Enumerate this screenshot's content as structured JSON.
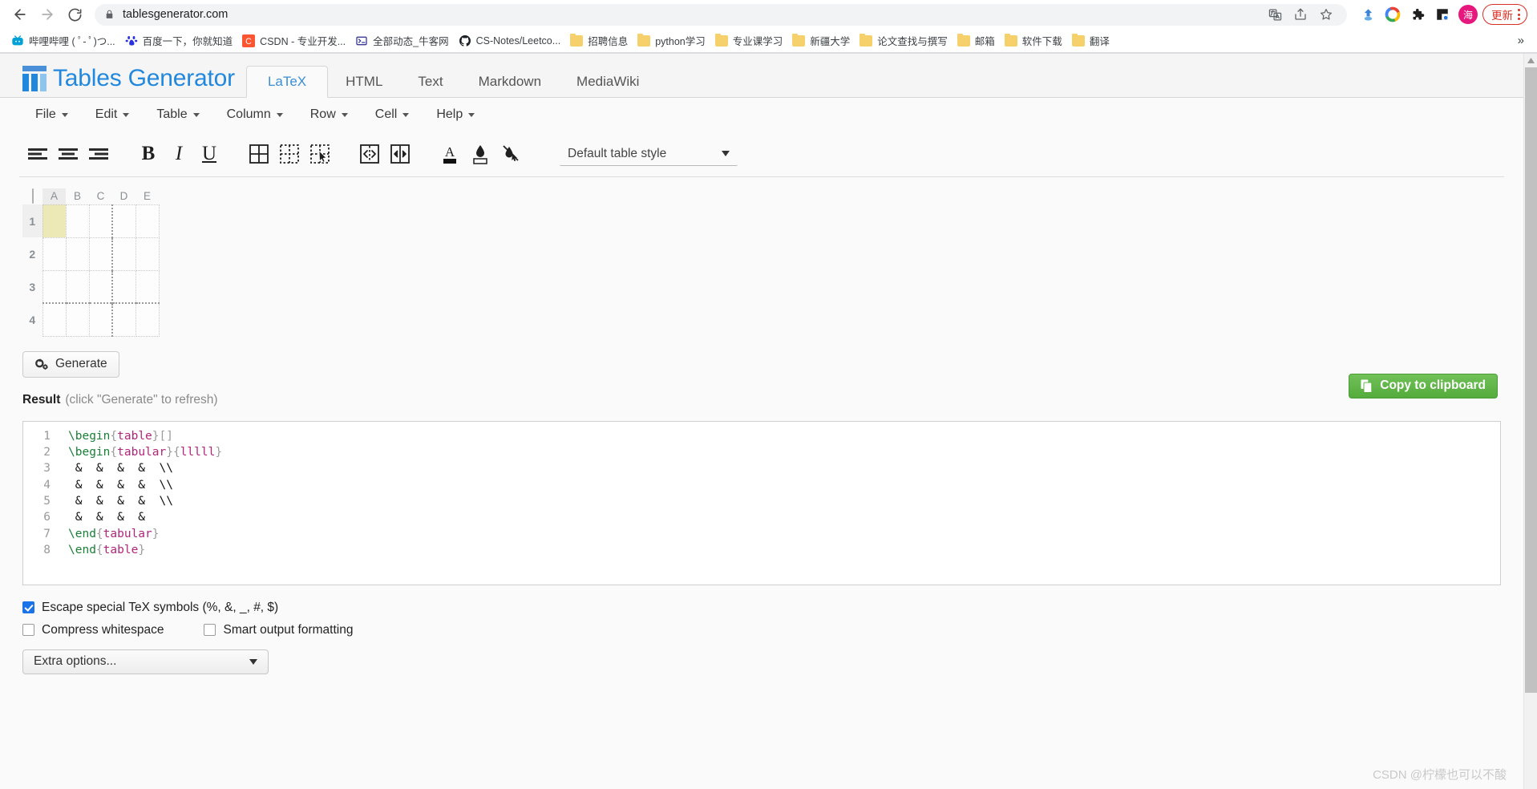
{
  "browser": {
    "back_icon": "back-arrow-icon",
    "forward_icon": "forward-arrow-icon",
    "reload_icon": "reload-icon",
    "lock_icon": "lock-icon",
    "url": "tablesgenerator.com",
    "omnibox_actions": [
      "translate-icon",
      "share-icon",
      "bookmark-star-icon"
    ],
    "extensions": [
      "blue-arrow-extension-icon",
      "google-colors-extension-icon",
      "puzzle-extensions-icon",
      "window-extension-icon"
    ],
    "profile_initial": "海",
    "update_label": "更新",
    "overflow_label": "»"
  },
  "bookmarks": [
    {
      "label": "哔哩哔哩 ( ﾟ- ﾟ)つ...",
      "icon": "bilibili-favicon"
    },
    {
      "label": "百度一下，你就知道",
      "icon": "baidu-favicon"
    },
    {
      "label": "CSDN - 专业开发...",
      "icon": "csdn-favicon"
    },
    {
      "label": "全部动态_牛客网",
      "icon": "nowcoder-favicon"
    },
    {
      "label": "CS-Notes/Leetco...",
      "icon": "github-favicon"
    },
    {
      "label": "招聘信息",
      "icon": "folder-icon"
    },
    {
      "label": "python学习",
      "icon": "folder-icon"
    },
    {
      "label": "专业课学习",
      "icon": "folder-icon"
    },
    {
      "label": "新疆大学",
      "icon": "folder-icon"
    },
    {
      "label": "论文查找与撰写",
      "icon": "folder-icon"
    },
    {
      "label": "邮箱",
      "icon": "folder-icon"
    },
    {
      "label": "软件下载",
      "icon": "folder-icon"
    },
    {
      "label": "翻译",
      "icon": "folder-icon"
    }
  ],
  "app": {
    "brand": "Tables Generator",
    "brand_color": "#2288dd",
    "format_tabs": [
      {
        "label": "LaTeX",
        "active": true
      },
      {
        "label": "HTML",
        "active": false
      },
      {
        "label": "Text",
        "active": false
      },
      {
        "label": "Markdown",
        "active": false
      },
      {
        "label": "MediaWiki",
        "active": false
      }
    ],
    "menu_items": [
      "File",
      "Edit",
      "Table",
      "Column",
      "Row",
      "Cell",
      "Help"
    ],
    "toolbar_icons": [
      "align-left-icon",
      "align-center-icon",
      "align-right-icon",
      "bold-icon",
      "italic-icon",
      "underline-icon",
      "borders-all-icon",
      "borders-none-icon",
      "borders-select-icon",
      "merge-cells-icon",
      "split-cells-icon",
      "text-color-icon",
      "fill-color-icon",
      "clear-formatting-icon"
    ],
    "table_style": {
      "selected": "Default table style",
      "caret": "chevron-down-icon"
    }
  },
  "grid": {
    "columns": [
      "A",
      "B",
      "C",
      "D",
      "E"
    ],
    "rows": [
      "1",
      "2",
      "3",
      "4"
    ],
    "selected_cell": "A1",
    "selected_fill": "#ece9b6",
    "heavy_column_left_border": "D",
    "heavy_row_top_border": "4"
  },
  "actions": {
    "generate_label": "Generate",
    "generate_icon": "gears-icon",
    "result_label": "Result",
    "result_hint": "(click \"Generate\" to refresh)",
    "copy_label": "Copy to clipboard",
    "copy_icon": "clipboard-copy-icon",
    "copy_color": "#5fb347"
  },
  "code": {
    "line_numbers": [
      "1",
      "2",
      "3",
      "4",
      "5",
      "6",
      "7",
      "8"
    ],
    "lines": [
      [
        {
          "t": "\\begin",
          "c": "cmd"
        },
        {
          "t": "{",
          "c": "brace"
        },
        {
          "t": "table",
          "c": "arg"
        },
        {
          "t": "}[]",
          "c": "brace"
        }
      ],
      [
        {
          "t": "\\begin",
          "c": "cmd"
        },
        {
          "t": "{",
          "c": "brace"
        },
        {
          "t": "tabular",
          "c": "arg"
        },
        {
          "t": "}{",
          "c": "brace"
        },
        {
          "t": "lllll",
          "c": "arg"
        },
        {
          "t": "}",
          "c": "brace"
        }
      ],
      [
        {
          "t": " &  &  &  &  \\\\",
          "c": "plain"
        }
      ],
      [
        {
          "t": " &  &  &  &  \\\\",
          "c": "plain"
        }
      ],
      [
        {
          "t": " &  &  &  &  \\\\",
          "c": "plain"
        }
      ],
      [
        {
          "t": " &  &  &  & ",
          "c": "plain"
        }
      ],
      [
        {
          "t": "\\end",
          "c": "cmd"
        },
        {
          "t": "{",
          "c": "brace"
        },
        {
          "t": "tabular",
          "c": "arg"
        },
        {
          "t": "}",
          "c": "brace"
        }
      ],
      [
        {
          "t": "\\end",
          "c": "cmd"
        },
        {
          "t": "{",
          "c": "brace"
        },
        {
          "t": "table",
          "c": "arg"
        },
        {
          "t": "}",
          "c": "brace"
        }
      ]
    ]
  },
  "options": {
    "escape_tex": {
      "label": "Escape special TeX symbols (%, &, _, #, $)",
      "checked": true
    },
    "compress_whitespace": {
      "label": "Compress whitespace",
      "checked": false
    },
    "smart_formatting": {
      "label": "Smart output formatting",
      "checked": false
    },
    "extra_options": {
      "label": "Extra options...",
      "caret": "chevron-down-icon"
    }
  },
  "watermark": "CSDN @柠檬也可以不酸"
}
